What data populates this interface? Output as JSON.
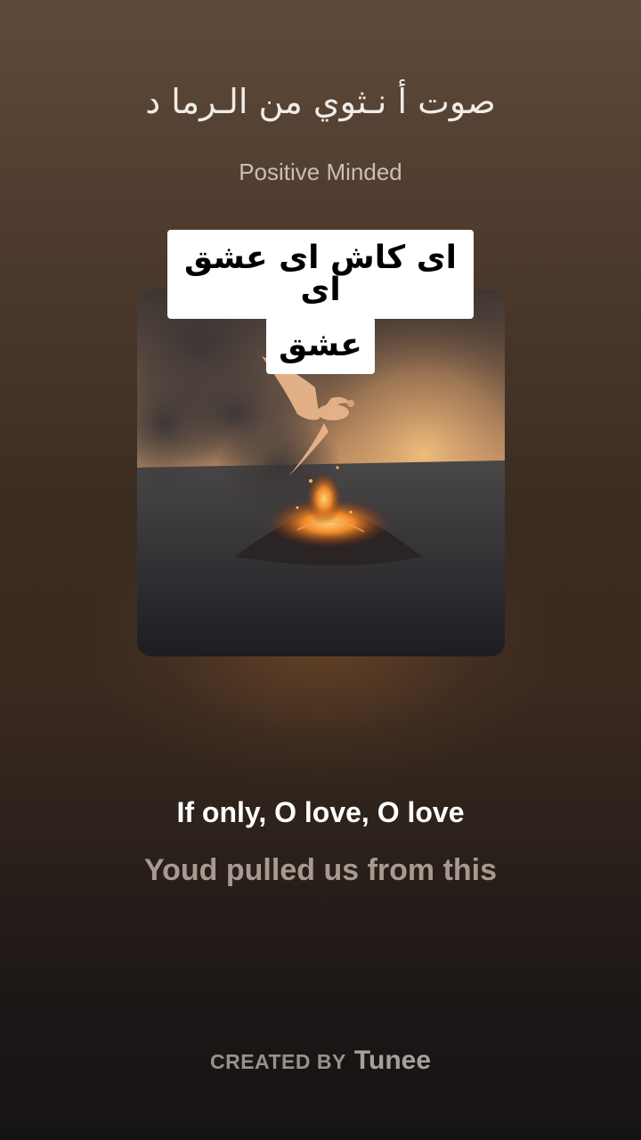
{
  "player": {
    "song_title": "صوت أ نـثوي من الـرما د",
    "artist": "Positive Minded",
    "cover_art": "phoenix-rising-from-volcano-image"
  },
  "caption": {
    "line1": "ای کاش ای عشق ای",
    "line2": "عشق"
  },
  "lyrics": {
    "current": "If only, O love, O love",
    "next": "Youd pulled us from this"
  },
  "footer": {
    "prefix": "CREATED BY",
    "brand": "Tunee"
  }
}
